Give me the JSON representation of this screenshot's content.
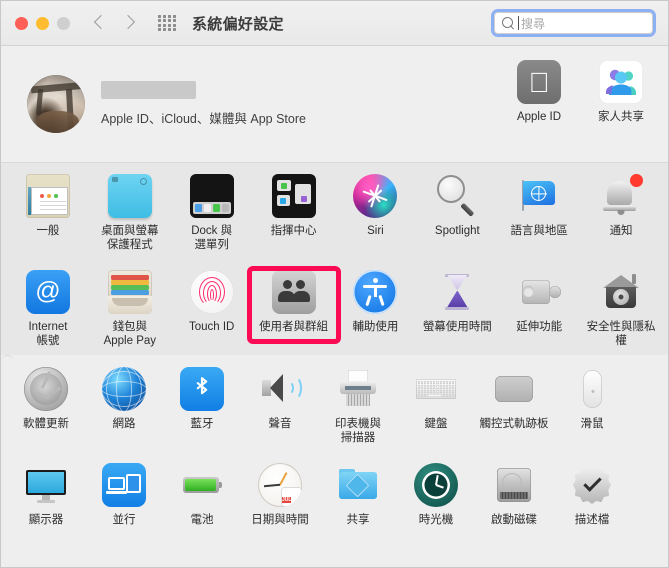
{
  "window": {
    "title": "系統偏好設定",
    "traffic_lights": [
      "close",
      "minimize",
      "zoom"
    ],
    "back_label": "返回",
    "forward_label": "前進",
    "grid_view_label": "顯示全部"
  },
  "search": {
    "placeholder": "搜尋",
    "value": "",
    "icon": "search-icon",
    "focused": true,
    "focus_ring_color": "#8cb0f2"
  },
  "account": {
    "name": "",
    "name_redacted": true,
    "subtitle": "Apple ID、iCloud、媒體與 App Store",
    "avatar": "user-photo"
  },
  "top_right_items": [
    {
      "label": "Apple ID",
      "icon": "apple-id-icon"
    },
    {
      "label": "家人共享",
      "icon": "family-sharing-icon"
    }
  ],
  "highlight": {
    "target_label": "使用者與群組",
    "color": "#fc0a54",
    "shape": "rectangle"
  },
  "sections": [
    {
      "name": "personal",
      "rows": [
        [
          {
            "label": "一般",
            "icon": "general-icon"
          },
          {
            "label": "桌面與螢幕\n保護程式",
            "icon": "desktop-screensaver-icon"
          },
          {
            "label": "Dock 與\n選單列",
            "icon": "dock-menubar-icon"
          },
          {
            "label": "指揮中心",
            "icon": "mission-control-icon"
          },
          {
            "label": "Siri",
            "icon": "siri-icon"
          },
          {
            "label": "Spotlight",
            "icon": "spotlight-icon"
          },
          {
            "label": "語言與地區",
            "icon": "language-region-icon"
          },
          {
            "label": "通知",
            "icon": "notifications-icon",
            "badge": true
          }
        ],
        [
          {
            "label": "Internet\n帳號",
            "icon": "internet-accounts-icon"
          },
          {
            "label": "錢包與\nApple Pay",
            "icon": "wallet-applepay-icon"
          },
          {
            "label": "Touch ID",
            "icon": "touch-id-icon"
          },
          {
            "label": "使用者與群組",
            "icon": "users-groups-icon",
            "highlighted": true
          },
          {
            "label": "輔助使用",
            "icon": "accessibility-icon"
          },
          {
            "label": "螢幕使用時間",
            "icon": "screen-time-icon"
          },
          {
            "label": "延伸功能",
            "icon": "extensions-icon"
          },
          {
            "label": "安全性與隱私權",
            "icon": "security-privacy-icon"
          }
        ]
      ]
    },
    {
      "name": "hardware",
      "rows": [
        [
          {
            "label": "軟體更新",
            "icon": "software-update-icon"
          },
          {
            "label": "網路",
            "icon": "network-icon"
          },
          {
            "label": "藍牙",
            "icon": "bluetooth-icon"
          },
          {
            "label": "聲音",
            "icon": "sound-icon"
          },
          {
            "label": "印表機與\n掃描器",
            "icon": "printers-scanners-icon"
          },
          {
            "label": "鍵盤",
            "icon": "keyboard-icon"
          },
          {
            "label": "觸控式軌跡板",
            "icon": "trackpad-icon"
          },
          {
            "label": "滑鼠",
            "icon": "mouse-icon"
          }
        ],
        [
          {
            "label": "顯示器",
            "icon": "displays-icon"
          },
          {
            "label": "並行",
            "icon": "sidecar-icon"
          },
          {
            "label": "電池",
            "icon": "battery-icon"
          },
          {
            "label": "日期與時間",
            "icon": "date-time-icon",
            "calendar_month": "JUL",
            "calendar_day": "17"
          },
          {
            "label": "共享",
            "icon": "sharing-icon"
          },
          {
            "label": "時光機",
            "icon": "time-machine-icon"
          },
          {
            "label": "啟動磁碟",
            "icon": "startup-disk-icon"
          },
          {
            "label": "描述檔",
            "icon": "profiles-icon"
          }
        ]
      ]
    }
  ]
}
